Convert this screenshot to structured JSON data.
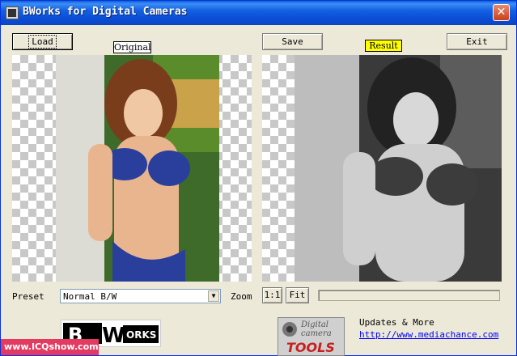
{
  "window": {
    "title": "BWorks for Digital Cameras",
    "close_glyph": "✕"
  },
  "toolbar": {
    "load_label": "Load",
    "original_tag": "Original",
    "save_label": "Save",
    "result_tag": "Result",
    "exit_label": "Exit"
  },
  "controls": {
    "preset_label": "Preset",
    "preset_value": "Normal B/W",
    "zoom_label": "Zoom",
    "zoom_1_1": "1:1",
    "zoom_fit": "Fit"
  },
  "footer": {
    "bw_logo_left": "B",
    "bw_logo_right": "W",
    "bw_logo_small": "ORKS",
    "dct_line1": "Digital",
    "dct_line2": "camera",
    "dct_line3": "TOOLS",
    "updates_label": "Updates & More",
    "url": "http://www.mediachance.com",
    "watermark": "www.ICQshow.com"
  },
  "colors": {
    "result_tag_bg": "#ffff00",
    "accent_title": "#0a45c5",
    "link": "#0000ff"
  }
}
